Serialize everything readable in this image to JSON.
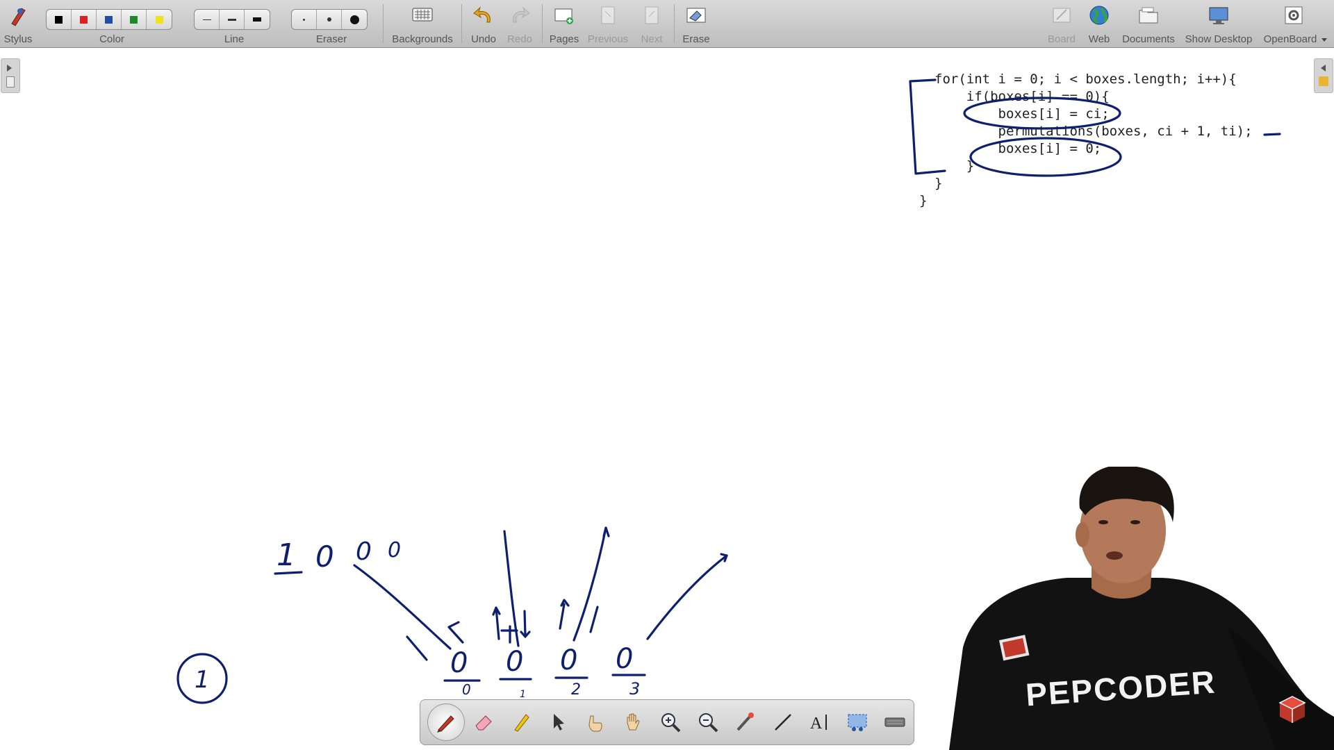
{
  "toolbar": {
    "stylus_label": "Stylus",
    "color_label": "Color",
    "line_label": "Line",
    "eraser_label": "Eraser",
    "backgrounds_label": "Backgrounds",
    "undo_label": "Undo",
    "redo_label": "Redo",
    "pages_label": "Pages",
    "previous_label": "Previous",
    "next_label": "Next",
    "erase_label": "Erase",
    "board_label": "Board",
    "web_label": "Web",
    "documents_label": "Documents",
    "show_desktop_label": "Show Desktop",
    "openboard_label": "OpenBoard",
    "colors": [
      "#000000",
      "#e02020",
      "#1f4ea8",
      "#1a8a2a",
      "#f2e21a"
    ]
  },
  "code": {
    "lines": [
      "for(int i = 0; i < boxes.length; i++){",
      "    if(boxes[i] == 0){",
      "        boxes[i] = ci;",
      "        permutations(boxes, ci + 1, ti);",
      "        boxes[i] = 0;",
      "    }",
      "}",
      "}"
    ]
  },
  "annotations": {
    "top_digits": [
      "1",
      "0",
      "0",
      "0"
    ],
    "box_values": [
      "0",
      "0",
      "0",
      "0"
    ],
    "box_indices": [
      "0",
      "1",
      "2",
      "3"
    ],
    "circled_number": "1"
  },
  "presenter": {
    "shirt_text": "PEPCODER"
  },
  "ink_color": "#0d1f6e"
}
